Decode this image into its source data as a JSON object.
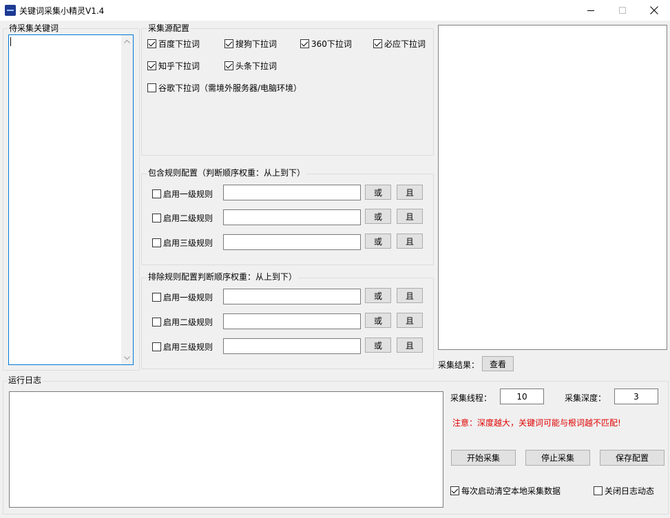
{
  "window": {
    "title": "关键词采集小精灵V1.4"
  },
  "keywords_panel": {
    "label": "待采集关键词",
    "value": ""
  },
  "source_config": {
    "label": "采集源配置",
    "sources": [
      {
        "label": "百度下拉词",
        "checked": true
      },
      {
        "label": "搜狗下拉词",
        "checked": true
      },
      {
        "label": "360下拉词",
        "checked": true
      },
      {
        "label": "必应下拉词",
        "checked": true
      },
      {
        "label": "知乎下拉词",
        "checked": true
      },
      {
        "label": "头条下拉词",
        "checked": true
      },
      {
        "label": "谷歌下拉词（需境外服务器/电脑环境）",
        "checked": false
      }
    ]
  },
  "include_rules": {
    "label": "包含规则配置（判断顺序权重：从上到下）",
    "rows": [
      {
        "label": "启用一级规则",
        "checked": false,
        "value": "",
        "or": "或",
        "and": "且"
      },
      {
        "label": "启用二级规则",
        "checked": false,
        "value": "",
        "or": "或",
        "and": "且"
      },
      {
        "label": "启用三级规则",
        "checked": false,
        "value": "",
        "or": "或",
        "and": "且"
      }
    ]
  },
  "exclude_rules": {
    "label": "排除规则配置判断顺序权重：从上到下）",
    "rows": [
      {
        "label": "启用一级规则",
        "checked": false,
        "value": "",
        "or": "或",
        "and": "且"
      },
      {
        "label": "启用二级规则",
        "checked": false,
        "value": "",
        "or": "或",
        "and": "且"
      },
      {
        "label": "启用三级规则",
        "checked": false,
        "value": "",
        "or": "或",
        "and": "且"
      }
    ]
  },
  "results": {
    "label": "采集结果：",
    "view_button": "查看"
  },
  "log": {
    "label": "运行日志",
    "value": ""
  },
  "settings": {
    "threads_label": "采集线程：",
    "threads_value": "10",
    "depth_label": "采集深度：",
    "depth_value": "3",
    "warning": "注意：深度越大，关键词可能与根词越不匹配!",
    "warning_color": "#e00000",
    "start_button": "开始采集",
    "stop_button": "停止采集",
    "save_button": "保存配置",
    "clear_local_label": "每次启动清空本地采集数据",
    "clear_local_checked": true,
    "close_log_label": "关闭日志动态",
    "close_log_checked": false
  },
  "icons": {
    "minimize": "minimize-icon",
    "maximize": "maximize-icon",
    "close": "close-icon",
    "scroll_up": "chevron-up-icon",
    "scroll_down": "chevron-down-icon"
  }
}
